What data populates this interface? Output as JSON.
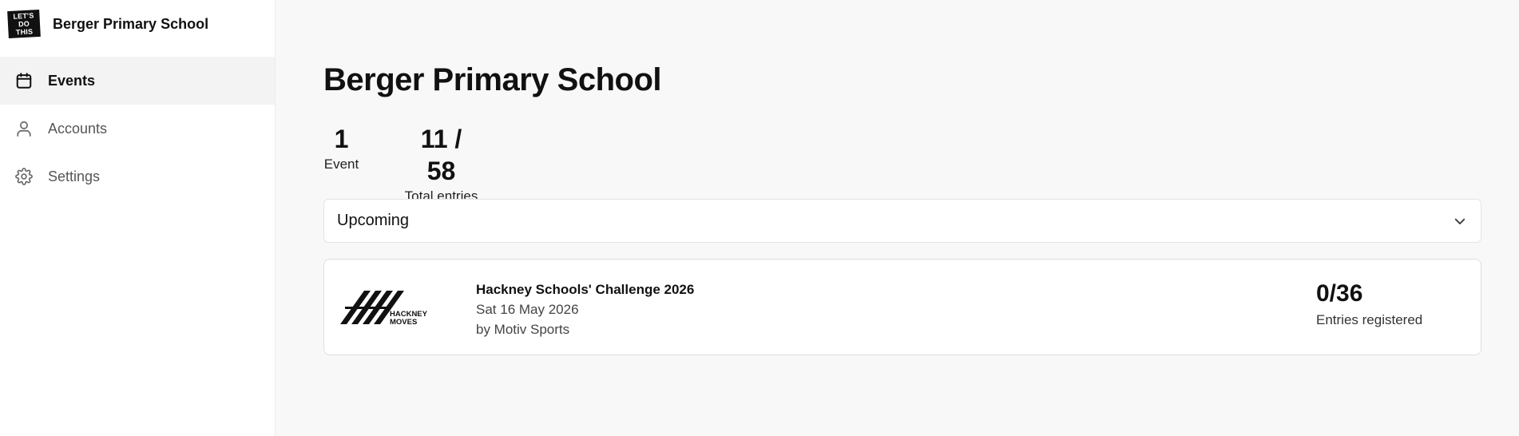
{
  "brand": {
    "logo_text": [
      "LET'S",
      "DO",
      "THIS"
    ],
    "name": "Berger Primary School"
  },
  "sidebar": {
    "items": [
      {
        "label": "Events",
        "icon": "calendar-icon",
        "active": true
      },
      {
        "label": "Accounts",
        "icon": "user-icon",
        "active": false
      },
      {
        "label": "Settings",
        "icon": "gear-icon",
        "active": false
      }
    ]
  },
  "main": {
    "title": "Berger Primary School",
    "stats": [
      {
        "value": "1",
        "label": "Event"
      },
      {
        "value": "11 / 58",
        "label": "Total entries"
      }
    ],
    "filter": {
      "selected": "Upcoming",
      "icon": "chevron-down-icon"
    },
    "events": [
      {
        "logo_text": [
          "HACKNEY",
          "MOVES"
        ],
        "title": "Hackney Schools' Challenge 2026",
        "date": "Sat 16 May 2026",
        "organizer": "by Motiv Sports",
        "entries": "0/36",
        "entries_label": "Entries registered"
      }
    ]
  },
  "colors": {
    "text": "#111111",
    "background": "#f8f8f8",
    "active_nav": "#f3f3f3",
    "border": "#dedede"
  }
}
